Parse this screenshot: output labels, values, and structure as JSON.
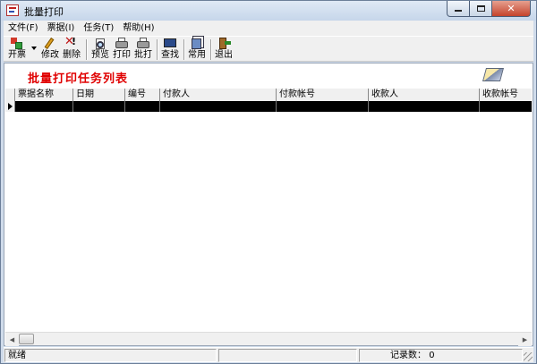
{
  "window": {
    "title": "批量打印"
  },
  "menu": [
    {
      "label": "文件(F)"
    },
    {
      "label": "票据(I)"
    },
    {
      "label": "任务(T)"
    },
    {
      "label": "帮助(H)"
    }
  ],
  "toolbar": {
    "items": [
      {
        "label": "开票",
        "icon": "new-ticket-icon"
      },
      {
        "label": "修改",
        "icon": "edit-icon"
      },
      {
        "label": "删除",
        "icon": "delete-icon"
      },
      {
        "label": "预览",
        "icon": "preview-icon"
      },
      {
        "label": "打印",
        "icon": "print-icon"
      },
      {
        "label": "批打",
        "icon": "batch-print-icon"
      },
      {
        "label": "查找",
        "icon": "find-icon"
      },
      {
        "label": "常用",
        "icon": "common-icon"
      },
      {
        "label": "退出",
        "icon": "exit-icon"
      }
    ]
  },
  "list": {
    "title": "批量打印任务列表",
    "columns": [
      "票据名称",
      "日期",
      "编号",
      "付款人",
      "付款帐号",
      "收款人",
      "收款帐号"
    ]
  },
  "status": {
    "text": "就绪",
    "record_label": "记录数：",
    "record_count": "0"
  }
}
